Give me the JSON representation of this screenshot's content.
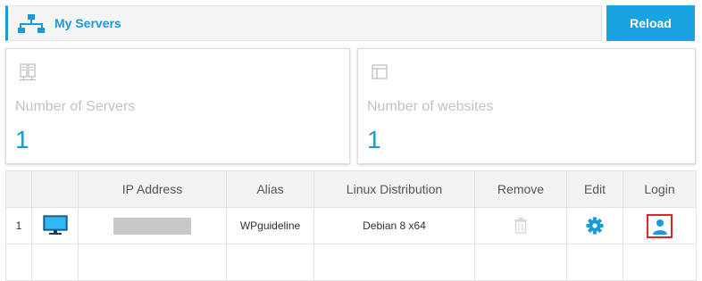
{
  "header": {
    "title": "My Servers",
    "reload_label": "Reload",
    "accent_color": "#1a9ad6"
  },
  "cards": [
    {
      "label": "Number of Servers",
      "value": "1",
      "icon": "server-icon"
    },
    {
      "label": "Number of websites",
      "value": "1",
      "icon": "website-icon"
    }
  ],
  "table": {
    "columns": [
      "",
      "",
      "IP Address",
      "Alias",
      "Linux Distribution",
      "Remove",
      "Edit",
      "Login"
    ],
    "rows": [
      {
        "index": "1",
        "icon": "monitor-icon",
        "ip_address": "",
        "alias": "WPguideline",
        "distribution": "Debian 8 x64",
        "remove_icon": "trash-icon",
        "edit_icon": "gear-icon",
        "login_icon": "user-icon"
      }
    ]
  }
}
